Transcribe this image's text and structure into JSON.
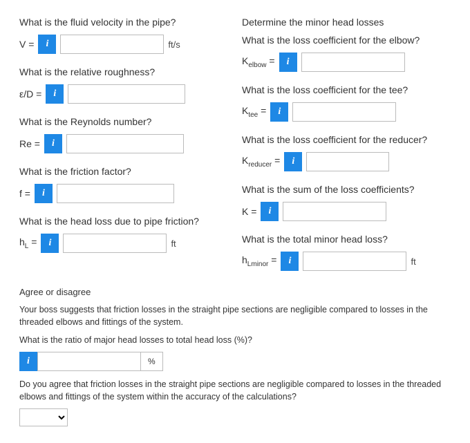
{
  "left": {
    "q_velocity": "What is the fluid velocity in the pipe?",
    "v_label": "V =",
    "v_unit": "ft/s",
    "q_roughness": "What is the relative roughness?",
    "ed_label": "ε/D =",
    "q_reynolds": "What is the Reynolds number?",
    "re_label": "Re =",
    "q_friction": "What is the friction factor?",
    "f_label": "f =",
    "q_headloss": "What is the head loss due to pipe friction?",
    "hl_prefix": "h",
    "hl_sub": "L",
    "hl_eq": " =",
    "hl_unit": "ft"
  },
  "right": {
    "heading": "Determine the minor head losses",
    "q_elbow": "What is the loss coefficient for the elbow?",
    "k_elbow_prefix": "K",
    "k_elbow_sub": "elbow",
    "eq": " =",
    "q_tee": "What is the loss coefficient for the tee?",
    "k_tee_prefix": "K",
    "k_tee_sub": "tee",
    "q_reducer": "What is the loss coefficient for the reducer?",
    "k_red_prefix": "K",
    "k_red_sub": "reducer",
    "q_sum": "What is the sum of the loss coefficients?",
    "k_sum_label": "K =",
    "q_total": "What is the total minor head loss?",
    "hlm_prefix": "h",
    "hlm_sub": "Lminor",
    "hlm_unit": "ft"
  },
  "bottom": {
    "heading": "Agree or disagree",
    "para1": "Your boss suggests that friction losses in the straight pipe sections are negligible compared to losses in the threaded elbows and fittings of the system.",
    "q_ratio": "What is the ratio of major head losses to total head loss (%)?",
    "pct": "%",
    "para2": "Do you agree that friction losses in the straight pipe sections are negligible compared to losses in the threaded elbows and fittings of the system within the accuracy of the calculations?"
  },
  "info_glyph": "i"
}
